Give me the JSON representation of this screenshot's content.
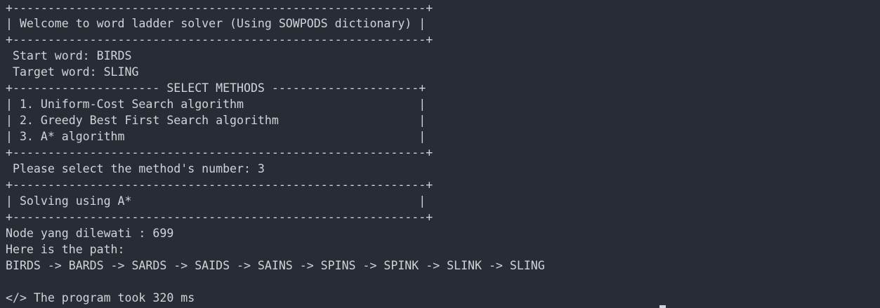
{
  "terminal": {
    "lines": [
      "+-----------------------------------------------------------+",
      "| Welcome to word ladder solver (Using SOWPODS dictionary) |",
      "+-----------------------------------------------------------+",
      " Start word: BIRDS",
      " Target word: SLING",
      "+--------------------- SELECT METHODS ---------------------+",
      "| 1. Uniform-Cost Search algorithm                         |",
      "| 2. Greedy Best First Search algorithm                    |",
      "| 3. A* algorithm                                          |",
      "+-----------------------------------------------------------+",
      " Please select the method's number: 3",
      "+-----------------------------------------------------------+",
      "| Solving using A*                                         |",
      "+-----------------------------------------------------------+",
      "Node yang dilewati : 699",
      "Here is the path:",
      "BIRDS -> BARDS -> SARDS -> SAIDS -> SAINS -> SPINS -> SPINK -> SLINK -> SLING",
      "",
      "</> The program took 320 ms"
    ]
  }
}
